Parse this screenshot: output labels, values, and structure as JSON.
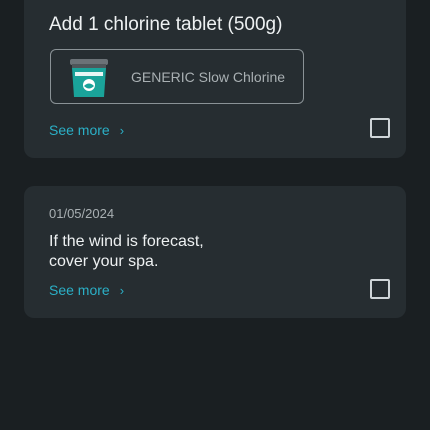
{
  "tasks": [
    {
      "title": "Add 1 chlorine tablet (500g)",
      "product": {
        "name": "GENERIC Slow Chlorine",
        "image_icon": "chlorine-bucket-icon",
        "bucket_color": "#1aa39a",
        "lid_color": "#6b7277"
      },
      "see_more_label": "See more",
      "chevron": "›",
      "checked": false
    },
    {
      "date": "01/05/2024",
      "text_lines": [
        "If the wind is forecast,",
        "cover your spa."
      ],
      "see_more_label": "See more",
      "chevron": "›",
      "checked": false
    }
  ],
  "colors": {
    "background": "#1a1f22",
    "card": "#262d31",
    "accent": "#2bb0c7",
    "text_primary": "#eef1f2",
    "text_secondary": "#a9b0b3"
  }
}
